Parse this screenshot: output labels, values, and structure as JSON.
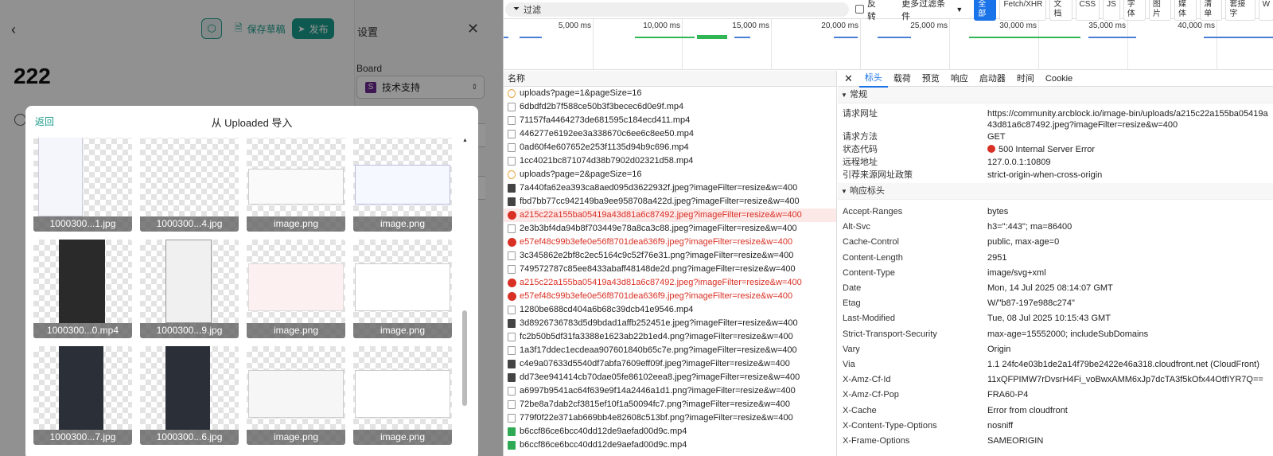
{
  "editor": {
    "title": "222",
    "save_draft_label": "保存草稿",
    "publish_label": "发布"
  },
  "settings": {
    "title": "设置",
    "board_label": "Board",
    "board_value": "技术支持",
    "board_icon_letter": "S"
  },
  "modal": {
    "back_label": "返回",
    "title": "从 Uploaded 导入",
    "files": [
      {
        "name": "1000300...1.jpg"
      },
      {
        "name": "1000300...4.jpg"
      },
      {
        "name": "image.png"
      },
      {
        "name": "image.png"
      },
      {
        "name": "1000300...0.mp4"
      },
      {
        "name": "1000300...9.jpg"
      },
      {
        "name": "image.png"
      },
      {
        "name": "image.png"
      },
      {
        "name": "1000300...7.jpg"
      },
      {
        "name": "1000300...6.jpg"
      },
      {
        "name": "image.png"
      },
      {
        "name": "image.png"
      }
    ]
  },
  "devtools": {
    "filter_placeholder": "过滤",
    "invert_label": "反转",
    "more_filters_label": "更多过滤条件",
    "type_filters": [
      "全部",
      "Fetch/XHR",
      "文档",
      "CSS",
      "JS",
      "字体",
      "图片",
      "媒体",
      "清单",
      "套接字",
      "W"
    ],
    "timeline_ticks": [
      "5,000 ms",
      "10,000 ms",
      "15,000 ms",
      "20,000 ms",
      "25,000 ms",
      "30,000 ms",
      "35,000 ms",
      "40,000 ms"
    ],
    "name_column": "名称",
    "requests": [
      {
        "name": "uploads?page=1&pageSize=16",
        "kind": "xhr",
        "error": false
      },
      {
        "name": "6dbdfd2b7f588ce50b3f3becec6d0e9f.mp4",
        "kind": "file",
        "error": false
      },
      {
        "name": "71157fa4464273de681595c184ecd411.mp4",
        "kind": "file",
        "error": false
      },
      {
        "name": "446277e6192ee3a338670c6ee6c8ee50.mp4",
        "kind": "file",
        "error": false
      },
      {
        "name": "0ad60f4e607652e253f1135d94b9c696.mp4",
        "kind": "file",
        "error": false
      },
      {
        "name": "1cc4021bc871074d38b7902d02321d58.mp4",
        "kind": "file",
        "error": false
      },
      {
        "name": "uploads?page=2&pageSize=16",
        "kind": "xhr",
        "error": false
      },
      {
        "name": "7a440fa62ea393ca8aed095d3622932f.jpeg?imageFilter=resize&w=400",
        "kind": "img-dark",
        "error": false
      },
      {
        "name": "fbd7bb77cc942149ba9ee958708a422d.jpeg?imageFilter=resize&w=400",
        "kind": "img-dark",
        "error": false
      },
      {
        "name": "a215c22a155ba05419a43d81a6c87492.jpeg?imageFilter=resize&w=400",
        "kind": "error",
        "error": true
      },
      {
        "name": "2e3b3bf4da94b8f703449e78a8ca3c88.jpeg?imageFilter=resize&w=400",
        "kind": "img",
        "error": false
      },
      {
        "name": "e57ef48c99b3efe0e56f8701dea636f9.jpeg?imageFilter=resize&w=400",
        "kind": "error",
        "error": true
      },
      {
        "name": "3c345862e2bf8c2ec5164c9c52f76e31.png?imageFilter=resize&w=400",
        "kind": "img",
        "error": false
      },
      {
        "name": "749572787c85ee8433abaff48148de2d.png?imageFilter=resize&w=400",
        "kind": "img",
        "error": false
      },
      {
        "name": "a215c22a155ba05419a43d81a6c87492.jpeg?imageFilter=resize&w=400",
        "kind": "error",
        "error": true
      },
      {
        "name": "e57ef48c99b3efe0e56f8701dea636f9.jpeg?imageFilter=resize&w=400",
        "kind": "error",
        "error": true
      },
      {
        "name": "1280be688cd404a6b68c39dcb41e9546.mp4",
        "kind": "file",
        "error": false
      },
      {
        "name": "3d8926736783d5d9bdad1affb252451e.jpeg?imageFilter=resize&w=400",
        "kind": "img-dark",
        "error": false
      },
      {
        "name": "fc2b50b5df31fa3388e1623ab22b1ed4.png?imageFilter=resize&w=400",
        "kind": "img",
        "error": false
      },
      {
        "name": "1a3f17ddec1ecdeaa907601840b65c7e.png?imageFilter=resize&w=400",
        "kind": "img",
        "error": false
      },
      {
        "name": "c4e9a07633d5540df7abfa7609eff09f.jpeg?imageFilter=resize&w=400",
        "kind": "img-dark",
        "error": false
      },
      {
        "name": "dd73ee941414cb70dae05fe86102eea8.jpeg?imageFilter=resize&w=400",
        "kind": "img-dark",
        "error": false
      },
      {
        "name": "a6997b9541ac64f639e9f14a2446a1d1.png?imageFilter=resize&w=400",
        "kind": "img",
        "error": false
      },
      {
        "name": "72be8a7dab2cf3815ef10f1a50094fc7.png?imageFilter=resize&w=400",
        "kind": "img",
        "error": false
      },
      {
        "name": "779f0f22e371ab669bb4e82608c513bf.png?imageFilter=resize&w=400",
        "kind": "img",
        "error": false
      },
      {
        "name": "b6ccf86ce6bcc40dd12de9aefad00d9c.mp4",
        "kind": "media",
        "error": false
      },
      {
        "name": "b6ccf86ce6bcc40dd12de9aefad00d9c.mp4",
        "kind": "media",
        "error": false
      }
    ],
    "detail_tabs": [
      "标头",
      "载荷",
      "预览",
      "响应",
      "启动器",
      "时间",
      "Cookie"
    ],
    "general": {
      "title": "常规",
      "items": [
        {
          "key": "请求网址",
          "value": "https://community.arcblock.io/image-bin/uploads/a215c22a155ba05419a43d81a6c87492.jpeg?imageFilter=resize&w=400"
        },
        {
          "key": "请求方法",
          "value": "GET"
        },
        {
          "key": "状态代码",
          "value": "500 Internal Server Error"
        },
        {
          "key": "远程地址",
          "value": "127.0.0.1:10809"
        },
        {
          "key": "引荐来源网址政策",
          "value": "strict-origin-when-cross-origin"
        }
      ]
    },
    "response_headers": {
      "title": "响应标头",
      "items": [
        {
          "key": "Accept-Ranges",
          "value": "bytes"
        },
        {
          "key": "Alt-Svc",
          "value": "h3=\":443\"; ma=86400"
        },
        {
          "key": "Cache-Control",
          "value": "public, max-age=0"
        },
        {
          "key": "Content-Length",
          "value": "2951"
        },
        {
          "key": "Content-Type",
          "value": "image/svg+xml"
        },
        {
          "key": "Date",
          "value": "Mon, 14 Jul 2025 08:14:07 GMT"
        },
        {
          "key": "Etag",
          "value": "W/\"b87-197e988c274\""
        },
        {
          "key": "Last-Modified",
          "value": "Tue, 08 Jul 2025 10:15:43 GMT"
        },
        {
          "key": "Strict-Transport-Security",
          "value": "max-age=15552000; includeSubDomains"
        },
        {
          "key": "Vary",
          "value": "Origin"
        },
        {
          "key": "Via",
          "value": "1.1 24fc4e03b1de2a14f79be2422e46a318.cloudfront.net (CloudFront)"
        },
        {
          "key": "X-Amz-Cf-Id",
          "value": "11xQFPIMW7rDvsrH4Fi_voBwxAMM6xJp7dcTA3f5kOfx44OtfIYR7Q=="
        },
        {
          "key": "X-Amz-Cf-Pop",
          "value": "FRA60-P4"
        },
        {
          "key": "X-Cache",
          "value": "Error from cloudfront"
        },
        {
          "key": "X-Content-Type-Options",
          "value": "nosniff"
        },
        {
          "key": "X-Frame-Options",
          "value": "SAMEORIGIN"
        }
      ]
    }
  },
  "colors": {
    "accent": "#1a9b8a",
    "devtools_blue": "#1a73e8",
    "error_red": "#d93025"
  }
}
